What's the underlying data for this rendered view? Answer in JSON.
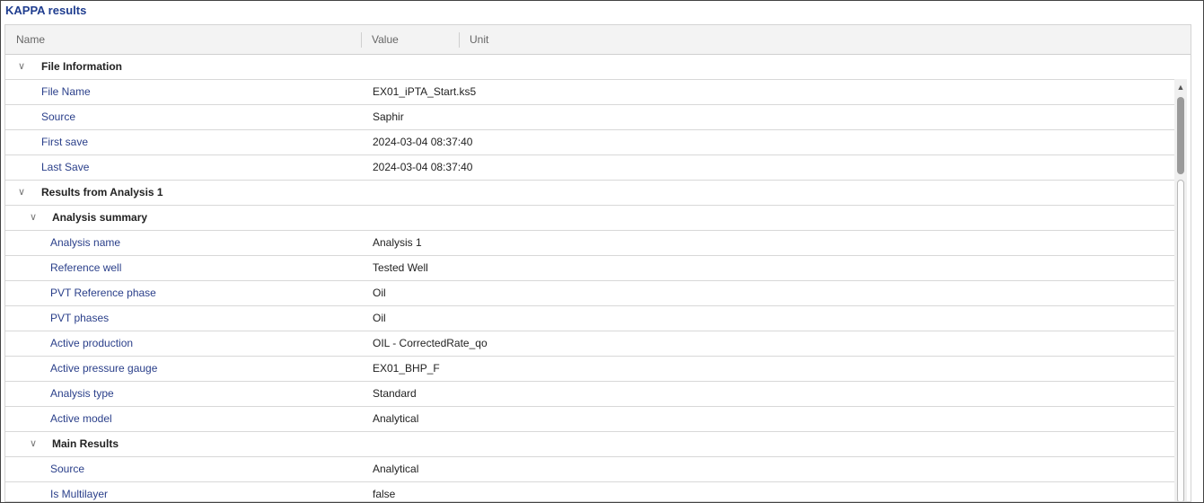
{
  "panel": {
    "title": "KAPPA results"
  },
  "columns": {
    "name": "Name",
    "value": "Value",
    "unit": "Unit"
  },
  "rows": [
    {
      "type": "group",
      "level": 0,
      "name": "File Information",
      "value": ""
    },
    {
      "type": "leaf",
      "level": 0,
      "name": "File Name",
      "value": "EX01_iPTA_Start.ks5"
    },
    {
      "type": "leaf",
      "level": 0,
      "name": "Source",
      "value": "Saphir"
    },
    {
      "type": "leaf",
      "level": 0,
      "name": "First save",
      "value": "2024-03-04 08:37:40"
    },
    {
      "type": "leaf",
      "level": 0,
      "name": "Last Save",
      "value": "2024-03-04 08:37:40"
    },
    {
      "type": "group",
      "level": 0,
      "name": "Results from Analysis 1",
      "value": ""
    },
    {
      "type": "group",
      "level": 1,
      "name": "Analysis summary",
      "value": ""
    },
    {
      "type": "leaf",
      "level": 1,
      "name": "Analysis name",
      "value": "Analysis 1"
    },
    {
      "type": "leaf",
      "level": 1,
      "name": "Reference well",
      "value": "Tested Well"
    },
    {
      "type": "leaf",
      "level": 1,
      "name": "PVT Reference phase",
      "value": "Oil"
    },
    {
      "type": "leaf",
      "level": 1,
      "name": "PVT phases",
      "value": "Oil"
    },
    {
      "type": "leaf",
      "level": 1,
      "name": "Active production",
      "value": "OIL - CorrectedRate_qo"
    },
    {
      "type": "leaf",
      "level": 1,
      "name": "Active pressure gauge",
      "value": "EX01_BHP_F"
    },
    {
      "type": "leaf",
      "level": 1,
      "name": "Analysis type",
      "value": "Standard"
    },
    {
      "type": "leaf",
      "level": 1,
      "name": "Active model",
      "value": "Analytical"
    },
    {
      "type": "group",
      "level": 1,
      "name": "Main Results",
      "value": ""
    },
    {
      "type": "leaf",
      "level": 1,
      "name": "Source",
      "value": "Analytical"
    },
    {
      "type": "leaf",
      "level": 1,
      "name": "Is Multilayer",
      "value": "false"
    }
  ],
  "icons": {
    "expand": "chevron-down-icon",
    "scroll_up": "arrow-up-icon",
    "scroll_down": "arrow-down-icon"
  }
}
